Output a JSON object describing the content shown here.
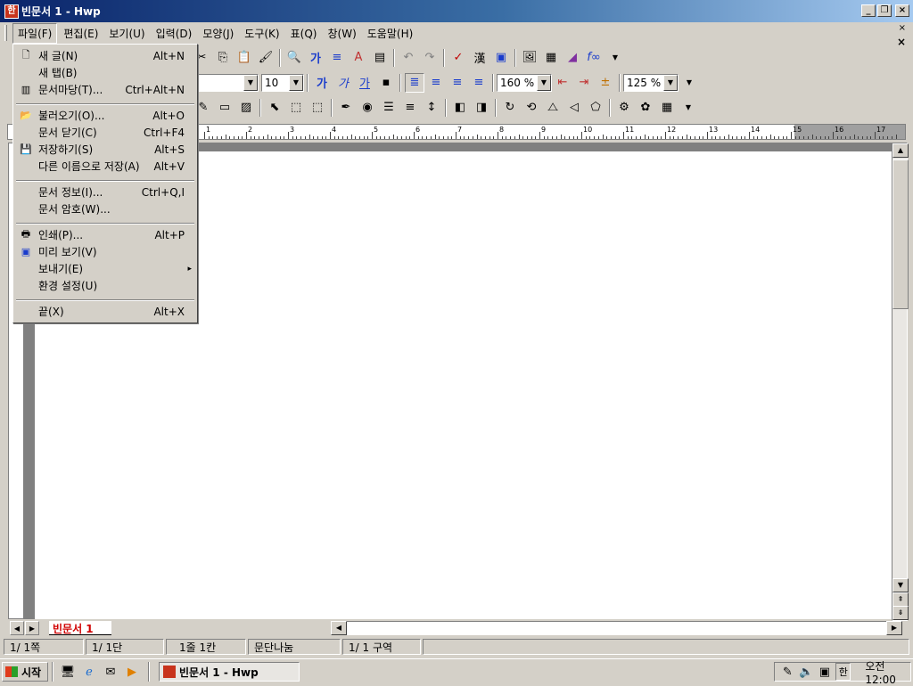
{
  "window": {
    "title": "빈문서 1 - Hwp"
  },
  "menubar": {
    "items": [
      "파일(F)",
      "편집(E)",
      "보기(U)",
      "입력(D)",
      "모양(J)",
      "도구(K)",
      "표(Q)",
      "창(W)",
      "도움말(H)"
    ],
    "close": "×"
  },
  "file_menu": {
    "items": [
      {
        "label": "새 글(N)",
        "shortcut": "Alt+N"
      },
      {
        "label": "새 탭(B)",
        "shortcut": ""
      },
      {
        "label": "문서마당(T)...",
        "shortcut": "Ctrl+Alt+N"
      },
      {
        "label": "불러오기(O)...",
        "shortcut": "Alt+O"
      },
      {
        "label": "문서 닫기(C)",
        "shortcut": "Ctrl+F4"
      },
      {
        "label": "저장하기(S)",
        "shortcut": "Alt+S"
      },
      {
        "label": "다른 이름으로 저장(A)",
        "shortcut": "Alt+V"
      },
      {
        "label": "문서 정보(I)...",
        "shortcut": "Ctrl+Q,I"
      },
      {
        "label": "문서 암호(W)...",
        "shortcut": ""
      },
      {
        "label": "인쇄(P)...",
        "shortcut": "Alt+P"
      },
      {
        "label": "미리 보기(V)",
        "shortcut": ""
      },
      {
        "label": "보내기(E)",
        "shortcut": "▸"
      },
      {
        "label": "환경 설정(U)",
        "shortcut": ""
      },
      {
        "label": "끝(X)",
        "shortcut": "Alt+X"
      }
    ]
  },
  "toolbar": {
    "font_size": "10",
    "zoom_160": "160 %",
    "zoom_125": "125 %",
    "bold": "가",
    "italic": "가",
    "underline": "가"
  },
  "ruler": {
    "numbers": [
      "1",
      "2",
      "3",
      "4",
      "5",
      "6",
      "7",
      "8",
      "9",
      "10",
      "11",
      "12",
      "13",
      "14",
      "15",
      "16",
      "17"
    ]
  },
  "tabs": {
    "doc_tab": "빈문서 1"
  },
  "statusbar": [
    "1/ 1쪽",
    "1/ 1단",
    "1줄 1칸",
    "문단나눔",
    "1/ 1 구역"
  ],
  "taskbar": {
    "start": "시작",
    "task": "빈문서 1 - Hwp",
    "time": "오전 12:00",
    "ime": "한"
  }
}
